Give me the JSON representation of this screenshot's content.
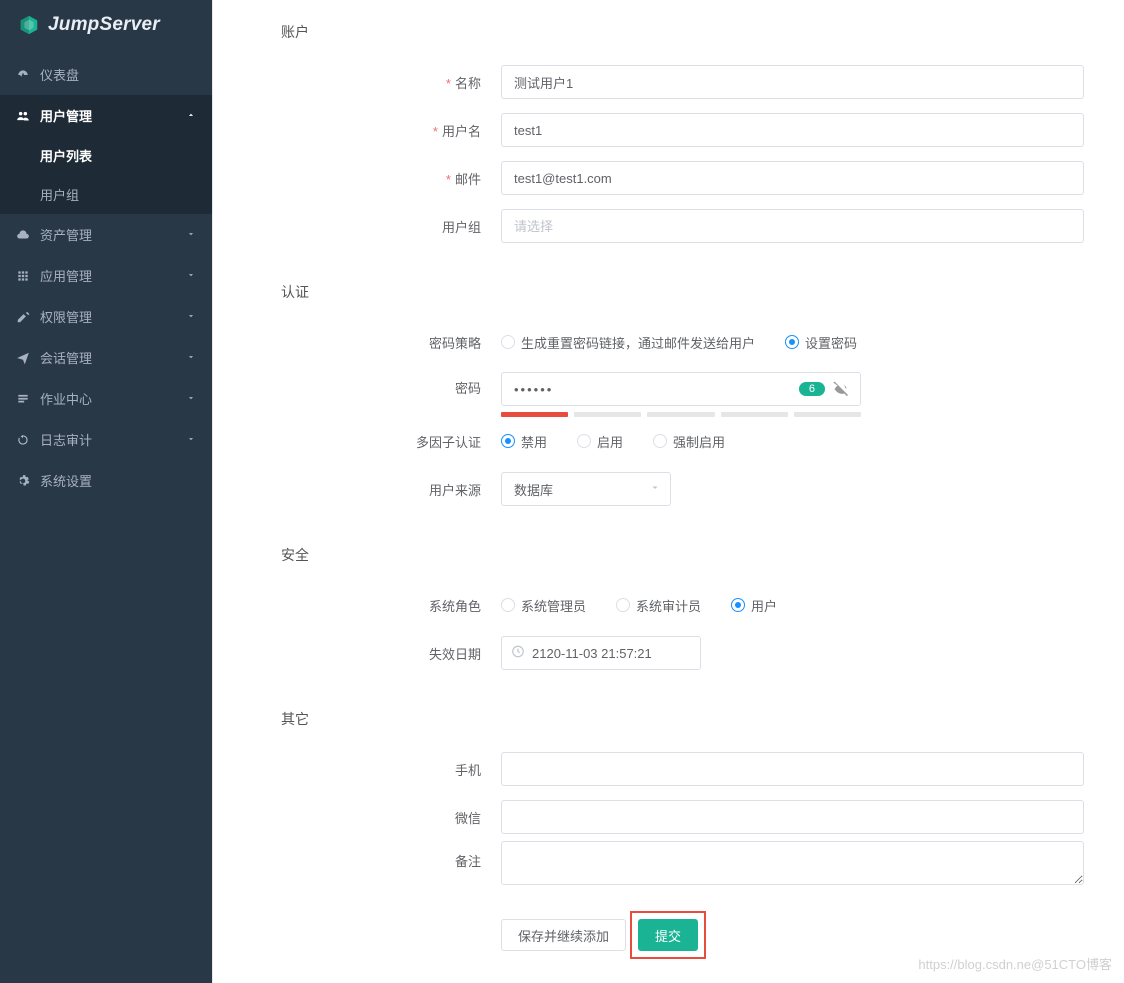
{
  "brand": {
    "name": "JumpServer"
  },
  "sidebar": {
    "items": [
      {
        "label": "仪表盘",
        "icon": "dashboard"
      },
      {
        "label": "用户管理",
        "icon": "users",
        "expanded": true,
        "children": [
          {
            "label": "用户列表",
            "selected": true
          },
          {
            "label": "用户组",
            "selected": false
          }
        ]
      },
      {
        "label": "资产管理",
        "icon": "cloud"
      },
      {
        "label": "应用管理",
        "icon": "grid"
      },
      {
        "label": "权限管理",
        "icon": "edit"
      },
      {
        "label": "会话管理",
        "icon": "send"
      },
      {
        "label": "作业中心",
        "icon": "tasks"
      },
      {
        "label": "日志审计",
        "icon": "history"
      },
      {
        "label": "系统设置",
        "icon": "settings"
      }
    ]
  },
  "form": {
    "account": {
      "title": "账户",
      "name_label": "名称",
      "name_value": "测试用户1",
      "username_label": "用户名",
      "username_value": "test1",
      "email_label": "邮件",
      "email_value": "test1@test1.com",
      "group_label": "用户组",
      "group_placeholder": "请选择"
    },
    "auth": {
      "title": "认证",
      "policy_label": "密码策略",
      "policy_opts": [
        {
          "label": "生成重置密码链接，通过邮件发送给用户",
          "checked": false
        },
        {
          "label": "设置密码",
          "checked": true
        }
      ],
      "password_label": "密码",
      "password_value": "••••••",
      "password_badge": "6",
      "mfa_label": "多因子认证",
      "mfa_opts": [
        {
          "label": "禁用",
          "checked": true
        },
        {
          "label": "启用",
          "checked": false
        },
        {
          "label": "强制启用",
          "checked": false
        }
      ],
      "source_label": "用户来源",
      "source_value": "数据库"
    },
    "security": {
      "title": "安全",
      "role_label": "系统角色",
      "role_opts": [
        {
          "label": "系统管理员",
          "checked": false
        },
        {
          "label": "系统审计员",
          "checked": false
        },
        {
          "label": "用户",
          "checked": true
        }
      ],
      "expire_label": "失效日期",
      "expire_value": "2120-11-03 21:57:21"
    },
    "other": {
      "title": "其它",
      "phone_label": "手机",
      "phone_value": "",
      "wechat_label": "微信",
      "wechat_value": "",
      "remark_label": "备注",
      "remark_value": ""
    },
    "actions": {
      "save_continue": "保存并继续添加",
      "submit": "提交"
    }
  },
  "watermark": "https://blog.csdn.ne@51CTO博客"
}
